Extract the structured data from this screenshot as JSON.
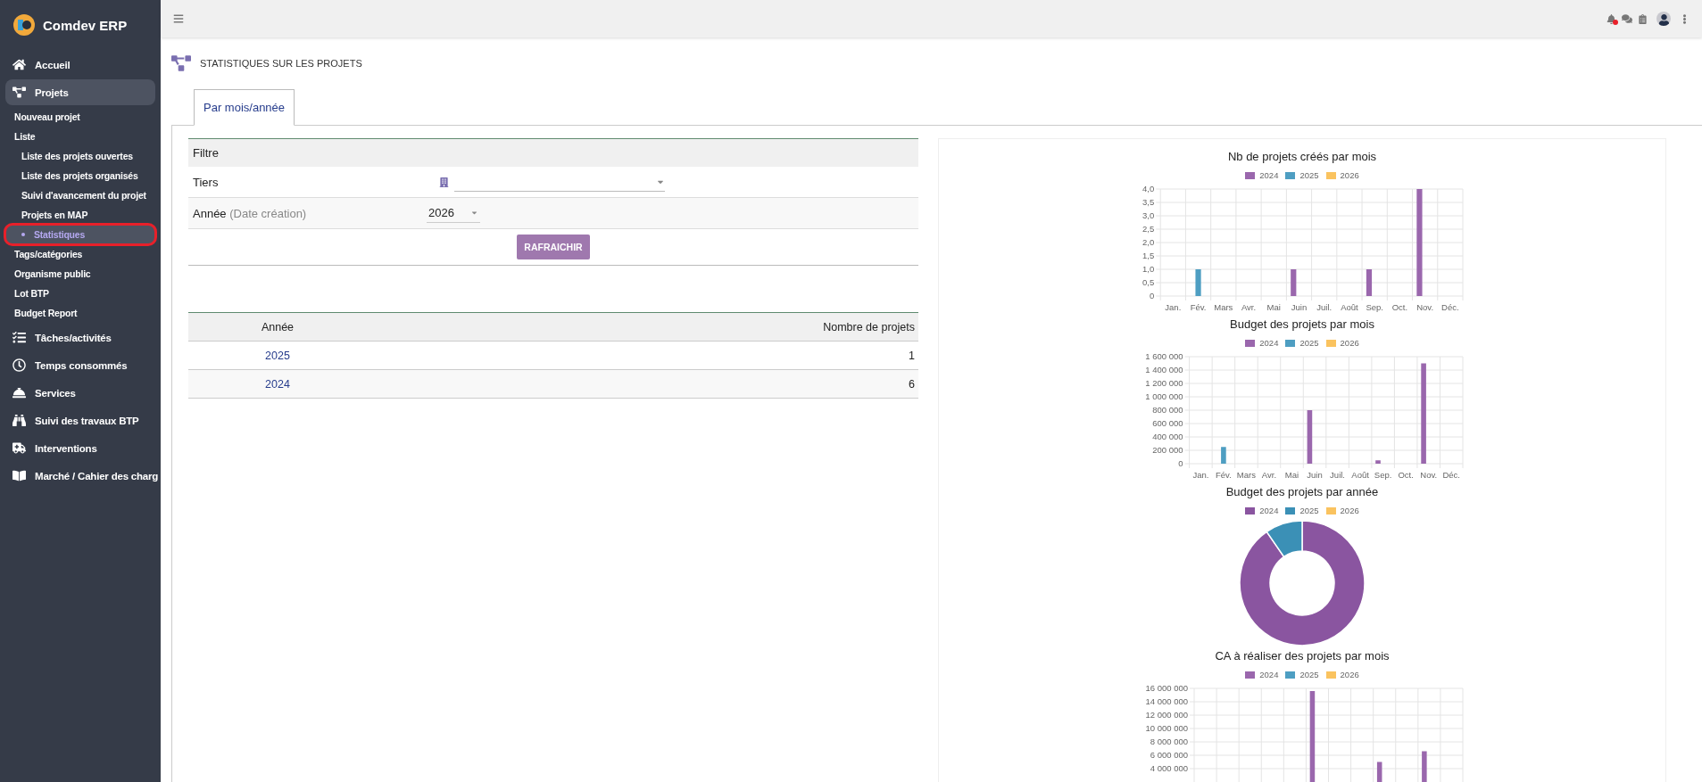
{
  "sidebar": {
    "brand": "Comdev ERP",
    "items": [
      {
        "label": "Accueil",
        "selected": false
      },
      {
        "label": "Projets",
        "selected": true,
        "children": [
          {
            "label": "Nouveau projet",
            "selected": false
          },
          {
            "label": "Liste",
            "selected": false,
            "children": [
              {
                "label": "Liste des projets ouvertes",
                "selected": false
              },
              {
                "label": "Liste des projets organisés",
                "selected": false
              },
              {
                "label": "Suivi d'avancement du projet",
                "selected": false
              },
              {
                "label": "Projets en MAP",
                "selected": false
              },
              {
                "label": "Statistiques",
                "selected": true
              }
            ]
          },
          {
            "label": "Tags/catégories",
            "selected": false
          },
          {
            "label": "Organisme public",
            "selected": false
          },
          {
            "label": "Lot BTP",
            "selected": false
          },
          {
            "label": "Budget Report",
            "selected": false
          }
        ]
      },
      {
        "label": "Tâches/activités",
        "selected": false
      },
      {
        "label": "Temps consommés",
        "selected": false
      },
      {
        "label": "Services",
        "selected": false
      },
      {
        "label": "Suivi des travaux BTP",
        "selected": false
      },
      {
        "label": "Interventions",
        "selected": false
      },
      {
        "label": "Marché / Cahier des charg",
        "selected": false
      }
    ]
  },
  "page_title": "STATISTIQUES SUR LES PROJETS",
  "tabs": [
    {
      "label": "Par mois/année",
      "selected": true
    }
  ],
  "filter": {
    "title": "Filtre",
    "fields": [
      {
        "kind": "combo",
        "label": "Tiers"
      },
      {
        "kind": "select",
        "label": "Année",
        "hint": "(Date création)",
        "value": "2026"
      }
    ],
    "button": "RAFRAICHIR"
  },
  "table": {
    "columns": [
      "Année",
      "Nombre de projets"
    ],
    "rows": [
      [
        "2025",
        "1"
      ],
      [
        "2024",
        "6"
      ]
    ]
  },
  "charts": [
    {
      "chart_data": {
        "type": "bar",
        "grid": true,
        "title": "Nb de projets créés par mois",
        "categories": [
          "Jan.",
          "Fév.",
          "Mars",
          "Avr.",
          "Mai",
          "Juin",
          "Juil.",
          "Août",
          "Sep.",
          "Oct.",
          "Nov.",
          "Déc."
        ],
        "ylim": [
          0,
          4
        ],
        "yticks": [
          {
            "value": 0,
            "label": "0"
          },
          {
            "value": 0.5,
            "label": "0,5"
          },
          {
            "value": 1,
            "label": "1,0"
          },
          {
            "value": 1.5,
            "label": "1,5"
          },
          {
            "value": 2,
            "label": "2,0"
          },
          {
            "value": 2.5,
            "label": "2,5"
          },
          {
            "value": 3,
            "label": "3,0"
          },
          {
            "value": 3.5,
            "label": "3,5"
          },
          {
            "value": 4,
            "label": "4,0"
          }
        ],
        "series": [
          {
            "name": "2024",
            "color": "#9a67ad",
            "values": [
              0,
              0,
              0,
              0,
              0,
              1,
              0,
              0,
              1,
              0,
              4,
              0
            ]
          },
          {
            "name": "2025",
            "color": "#4e9ec2",
            "values": [
              0,
              1,
              0,
              0,
              0,
              0,
              0,
              0,
              0,
              0,
              0,
              0
            ]
          },
          {
            "name": "2026",
            "color": "#fac35f",
            "values": [
              0,
              0,
              0,
              0,
              0,
              0,
              0,
              0,
              0,
              0,
              0,
              0
            ]
          }
        ]
      }
    },
    {
      "chart_data": {
        "type": "bar",
        "grid": true,
        "title": "Budget des projets par mois",
        "categories": [
          "Jan.",
          "Fév.",
          "Mars",
          "Avr.",
          "Mai",
          "Juin",
          "Juil.",
          "Août",
          "Sep.",
          "Oct.",
          "Nov.",
          "Déc."
        ],
        "ylim": [
          0,
          1600000
        ],
        "yticks": [
          {
            "value": 0,
            "label": "0"
          },
          {
            "value": 200000,
            "label": "200 000"
          },
          {
            "value": 400000,
            "label": "400 000"
          },
          {
            "value": 600000,
            "label": "600 000"
          },
          {
            "value": 800000,
            "label": "800 000"
          },
          {
            "value": 1000000,
            "label": "1 000 000"
          },
          {
            "value": 1200000,
            "label": "1 200 000"
          },
          {
            "value": 1400000,
            "label": "1 400 000"
          },
          {
            "value": 1600000,
            "label": "1 600 000"
          }
        ],
        "series": [
          {
            "name": "2024",
            "color": "#9a67ad",
            "values": [
              0,
              0,
              0,
              0,
              0,
              800000,
              0,
              0,
              50000,
              0,
              1500000,
              0
            ]
          },
          {
            "name": "2025",
            "color": "#4e9ec2",
            "values": [
              0,
              250000,
              0,
              0,
              0,
              0,
              0,
              0,
              0,
              0,
              0,
              0
            ]
          },
          {
            "name": "2026",
            "color": "#fac35f",
            "values": [
              0,
              0,
              0,
              0,
              0,
              0,
              0,
              0,
              0,
              0,
              0,
              0
            ]
          }
        ]
      }
    },
    {
      "chart_data": {
        "type": "donut",
        "title": "Budget des projets par année",
        "categories": [
          "2024",
          "2025",
          "2026"
        ],
        "values": [
          90.4,
          9.6,
          0
        ],
        "colors": [
          "#8a55a0",
          "#3b90b6",
          "#fac35f"
        ]
      }
    },
    {
      "chart_data": {
        "type": "bar",
        "grid": true,
        "title": "CA à réaliser des projets par mois",
        "ylim": [
          0,
          16000000
        ],
        "yticks": [
          {
            "value": 4000000,
            "label": "4 000 000"
          },
          {
            "value": 6000000,
            "label": "6 000 000"
          },
          {
            "value": 8000000,
            "label": "8 000 000"
          },
          {
            "value": 10000000,
            "label": "10 000 000"
          },
          {
            "value": 12000000,
            "label": "12 000 000"
          },
          {
            "value": 14000000,
            "label": "14 000 000"
          },
          {
            "value": 16000000,
            "label": "16 000 000"
          }
        ],
        "series": [
          {
            "name": "2024",
            "color": "#9a67ad",
            "values": [
              0,
              0,
              0,
              0,
              0,
              15600000,
              0,
              0,
              5000000,
              0,
              6600000,
              0
            ]
          },
          {
            "name": "2025",
            "color": "#4e9ec2",
            "values": [
              0,
              0,
              0,
              0,
              0,
              0,
              0,
              0,
              0,
              0,
              0,
              0
            ]
          },
          {
            "name": "2026",
            "color": "#fac35f",
            "values": [
              0,
              0,
              0,
              0,
              0,
              0,
              0,
              0,
              0,
              0,
              0,
              0
            ]
          }
        ]
      }
    }
  ]
}
